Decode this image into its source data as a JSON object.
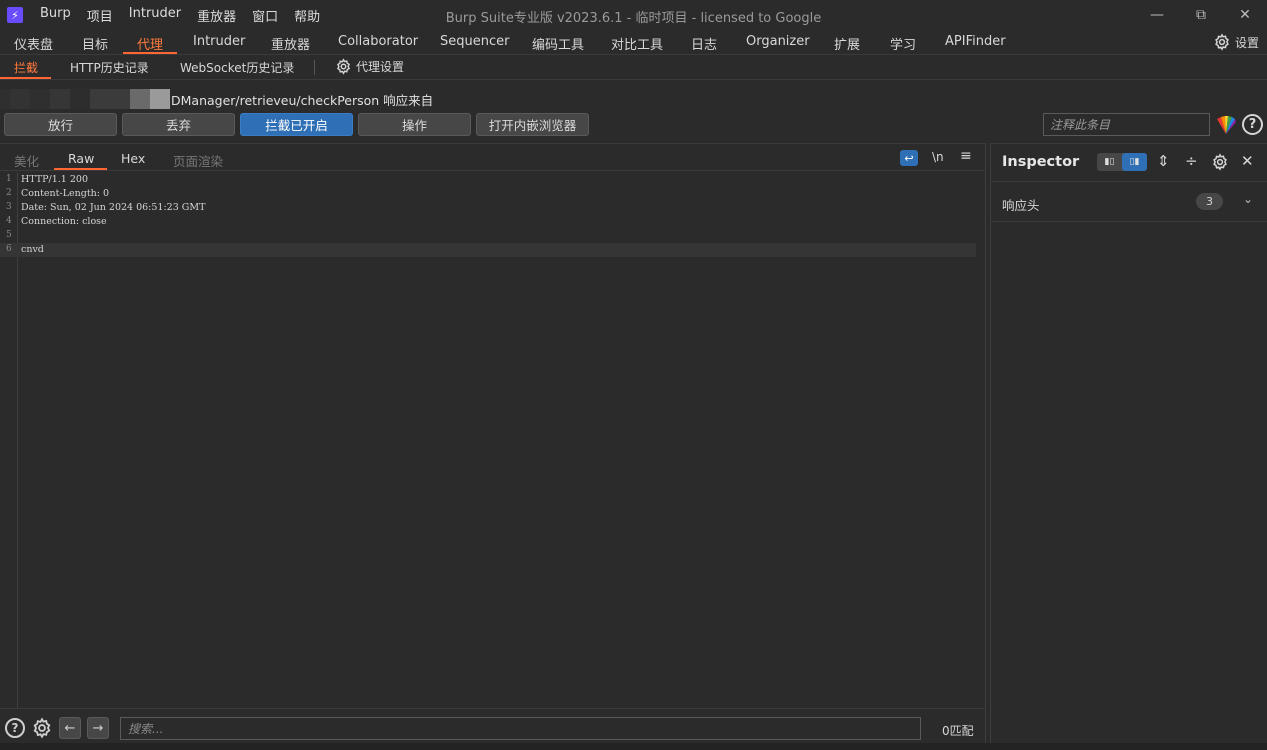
{
  "titlebar": {
    "logo": "⚡",
    "menus": [
      "Burp",
      "项目",
      "Intruder",
      "重放器",
      "窗口",
      "帮助"
    ],
    "title": "Burp Suite专业版  v2023.6.1 - 临时项目 - licensed to Google",
    "controls": {
      "minimize": "—",
      "restore": "⧉",
      "close": "✕"
    }
  },
  "main_tabs": [
    "仪表盘",
    "目标",
    "代理",
    "Intruder",
    "重放器",
    "Collaborator",
    "Sequencer",
    "编码工具",
    "对比工具",
    "日志",
    "Organizer",
    "扩展",
    "学习",
    "APIFinder"
  ],
  "main_tabs_active": "代理",
  "settings_label": "设置",
  "sub_tabs": [
    "拦截",
    "HTTP历史记录",
    "WebSocket历史记录"
  ],
  "sub_tabs_active": "拦截",
  "proxy_settings_label": "代理设置",
  "request_info": "DManager/retrieveu/checkPerson 响应来自",
  "buttons": {
    "forward": "放行",
    "drop": "丢弃",
    "intercept": "拦截已开启",
    "action": "操作",
    "browser": "打开内嵌浏览器"
  },
  "comment_placeholder": "注释此条目",
  "editor": {
    "tabs": [
      "美化",
      "Raw",
      "Hex",
      "页面渲染"
    ],
    "active_tab": "Raw",
    "newline_label": "\\n",
    "menu_label": "≡",
    "lines": [
      {
        "num": "1",
        "text": "HTTP/1.1 200"
      },
      {
        "num": "2",
        "text": "Content-Length: 0"
      },
      {
        "num": "3",
        "text": "Date: Sun, 02 Jun 2024 06:51:23 GMT"
      },
      {
        "num": "4",
        "text": "Connection: close"
      },
      {
        "num": "5",
        "text": ""
      },
      {
        "num": "6",
        "text": "cnvd"
      }
    ]
  },
  "search": {
    "placeholder": "搜索...",
    "match_count": "0匹配"
  },
  "inspector": {
    "title": "Inspector",
    "section_label": "响应头",
    "section_count": "3"
  },
  "colors": {
    "accent": "#ff6633",
    "primary_button": "#2f6fb5",
    "background": "#2b2b2b"
  }
}
